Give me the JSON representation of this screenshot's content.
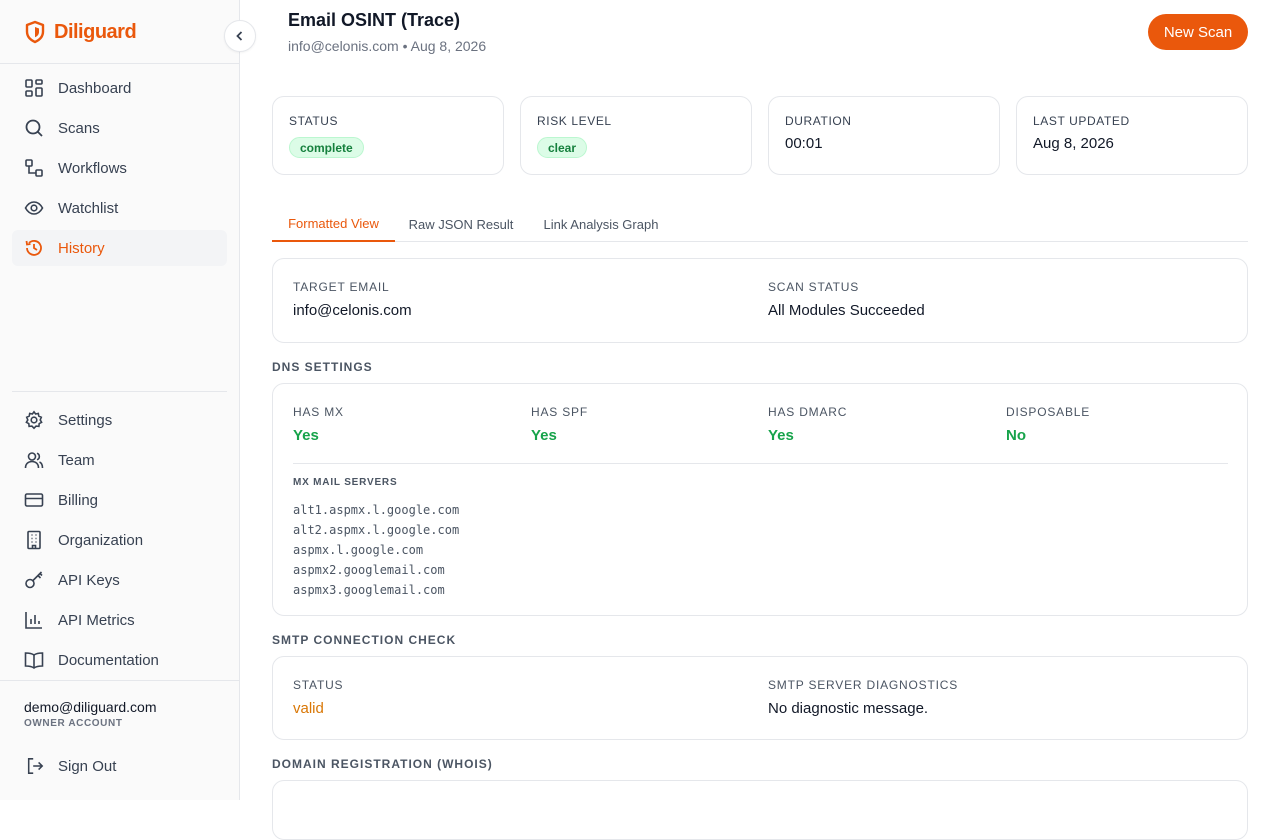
{
  "brand": {
    "name": "Diliguard"
  },
  "nav": {
    "primary": [
      {
        "label": "Dashboard",
        "icon": "grid-icon"
      },
      {
        "label": "Scans",
        "icon": "search-icon"
      },
      {
        "label": "Workflows",
        "icon": "workflow-icon"
      },
      {
        "label": "Watchlist",
        "icon": "eye-icon"
      },
      {
        "label": "History",
        "icon": "history-icon",
        "active": true
      }
    ],
    "secondary": [
      {
        "label": "Settings",
        "icon": "gear-icon"
      },
      {
        "label": "Team",
        "icon": "users-icon"
      },
      {
        "label": "Billing",
        "icon": "credit-card-icon"
      },
      {
        "label": "Organization",
        "icon": "building-icon"
      },
      {
        "label": "API Keys",
        "icon": "key-icon"
      },
      {
        "label": "API Metrics",
        "icon": "bar-chart-icon"
      },
      {
        "label": "Documentation",
        "icon": "book-icon"
      }
    ]
  },
  "account": {
    "email": "demo@diliguard.com",
    "role": "OWNER ACCOUNT",
    "signout": "Sign Out"
  },
  "header": {
    "title": "Email OSINT (Trace)",
    "subtitle": "info@celonis.com • Aug 8, 2026",
    "new_scan": "New Scan"
  },
  "stats": {
    "status": {
      "label": "STATUS",
      "value": "complete"
    },
    "risk": {
      "label": "RISK LEVEL",
      "value": "clear"
    },
    "duration": {
      "label": "DURATION",
      "value": "00:01"
    },
    "updated": {
      "label": "LAST UPDATED",
      "value": "Aug 8, 2026"
    }
  },
  "tabs": [
    "Formatted View",
    "Raw JSON Result",
    "Link Analysis Graph"
  ],
  "summary": {
    "target_label": "TARGET EMAIL",
    "target_value": "info@celonis.com",
    "scan_label": "SCAN STATUS",
    "scan_value": "All Modules Succeeded"
  },
  "dns": {
    "title": "DNS SETTINGS",
    "fields": [
      {
        "label": "HAS MX",
        "value": "Yes"
      },
      {
        "label": "HAS SPF",
        "value": "Yes"
      },
      {
        "label": "HAS DMARC",
        "value": "Yes"
      },
      {
        "label": "DISPOSABLE",
        "value": "No"
      }
    ],
    "mx_title": "MX MAIL SERVERS",
    "mx": [
      "alt1.aspmx.l.google.com",
      "alt2.aspmx.l.google.com",
      "aspmx.l.google.com",
      "aspmx2.googlemail.com",
      "aspmx3.googlemail.com"
    ]
  },
  "smtp": {
    "title": "SMTP CONNECTION CHECK",
    "status_label": "STATUS",
    "status_value": "valid",
    "diag_label": "SMTP SERVER DIAGNOSTICS",
    "diag_value": "No diagnostic message."
  },
  "whois": {
    "title": "DOMAIN REGISTRATION (WHOIS)"
  },
  "colors": {
    "accent": "#ea580c",
    "success": "#16a34a",
    "warning": "#d97706"
  }
}
